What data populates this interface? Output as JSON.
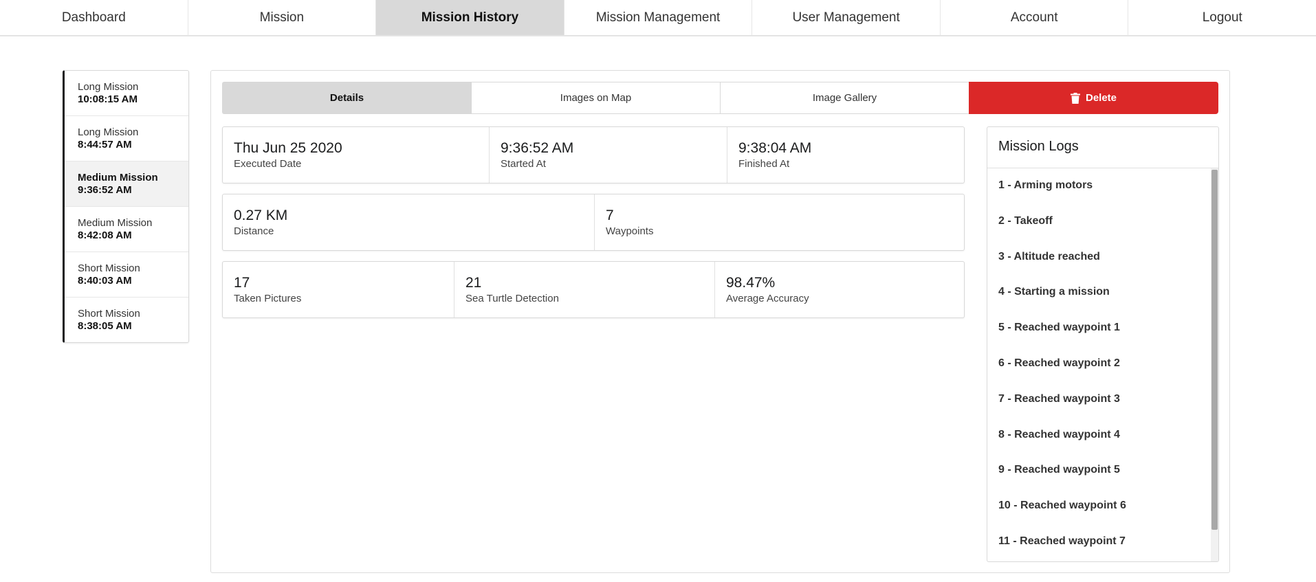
{
  "nav": {
    "items": [
      {
        "label": "Dashboard"
      },
      {
        "label": "Mission"
      },
      {
        "label": "Mission History",
        "active": true
      },
      {
        "label": "Mission Management"
      },
      {
        "label": "User Management"
      },
      {
        "label": "Account"
      },
      {
        "label": "Logout"
      }
    ]
  },
  "missions": [
    {
      "name": "Long Mission",
      "time": "10:08:15 AM"
    },
    {
      "name": "Long Mission",
      "time": "8:44:57 AM"
    },
    {
      "name": "Medium Mission",
      "time": "9:36:52 AM",
      "active": true
    },
    {
      "name": "Medium Mission",
      "time": "8:42:08 AM"
    },
    {
      "name": "Short Mission",
      "time": "8:40:03 AM"
    },
    {
      "name": "Short Mission",
      "time": "8:38:05 AM"
    }
  ],
  "tabs": {
    "details": "Details",
    "images_on_map": "Images on Map",
    "image_gallery": "Image Gallery",
    "delete": "Delete"
  },
  "stats": {
    "executed_date": {
      "value": "Thu Jun 25 2020",
      "label": "Executed Date"
    },
    "started_at": {
      "value": "9:36:52 AM",
      "label": "Started At"
    },
    "finished_at": {
      "value": "9:38:04 AM",
      "label": "Finished At"
    },
    "distance": {
      "value": "0.27 KM",
      "label": "Distance"
    },
    "waypoints": {
      "value": "7",
      "label": "Waypoints"
    },
    "taken_pictures": {
      "value": "17",
      "label": "Taken Pictures"
    },
    "sea_turtle_detection": {
      "value": "21",
      "label": "Sea Turtle Detection"
    },
    "average_accuracy": {
      "value": "98.47%",
      "label": "Average Accuracy"
    }
  },
  "logs": {
    "title": "Mission Logs",
    "items": [
      "1 - Arming motors",
      "2 - Takeoff",
      "3 - Altitude reached",
      "4 - Starting a mission",
      "5 - Reached waypoint 1",
      "6 - Reached waypoint 2",
      "7 - Reached waypoint 3",
      "8 - Reached waypoint 4",
      "9 - Reached waypoint 5",
      "10 - Reached waypoint 6",
      "11 - Reached waypoint 7"
    ]
  },
  "colors": {
    "delete": "#db2828",
    "active_tab": "#d9d9d9",
    "active_mission": "#f2f2f2"
  },
  "icons": {
    "delete": "trash-icon"
  }
}
